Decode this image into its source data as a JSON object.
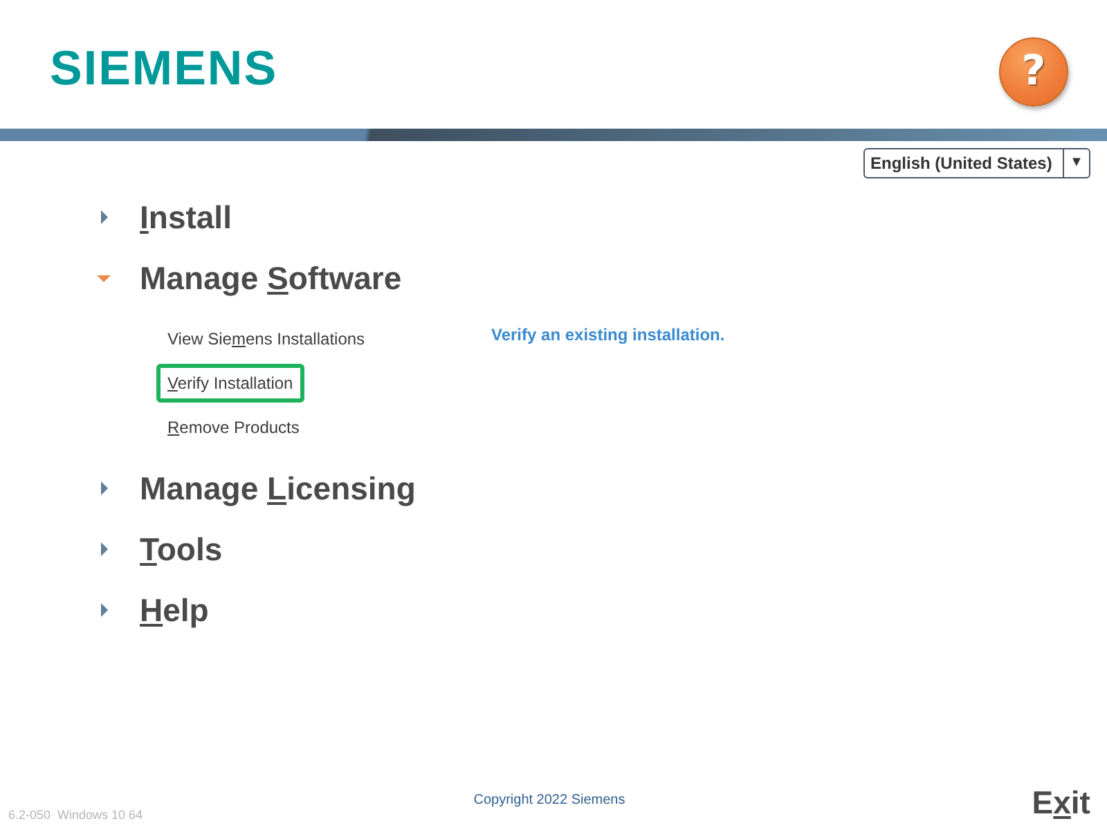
{
  "header": {
    "logo": "SIEMENS",
    "help_button": "?"
  },
  "language_select": {
    "value": "English (United States)",
    "arrow": "▼"
  },
  "menu": [
    {
      "label": {
        "access_key": "I",
        "after": "nstall"
      },
      "expanded": false
    },
    {
      "label": {
        "before": "Manage ",
        "access_key": "S",
        "after": "oftware"
      },
      "expanded": true,
      "children": [
        {
          "label": {
            "before": "View Sie",
            "access_key": "m",
            "after": "ens Installations"
          },
          "selected": false
        },
        {
          "label": {
            "access_key": "V",
            "after": "erify Installation"
          },
          "selected": true
        },
        {
          "label": {
            "access_key": "R",
            "after": "emove Products"
          },
          "selected": false
        }
      ]
    },
    {
      "label": {
        "before": "Manage ",
        "access_key": "L",
        "after": "icensing"
      },
      "expanded": false
    },
    {
      "label": {
        "access_key": "T",
        "after": "ools"
      },
      "expanded": false
    },
    {
      "label": {
        "access_key": "H",
        "after": "elp"
      },
      "expanded": false
    }
  ],
  "description": "Verify an existing installation.",
  "footer": {
    "version": "6.2-050  Windows 10 64",
    "copyright": "Copyright 2022 Siemens",
    "exit": {
      "before": "E",
      "access_key": "x",
      "after": "it"
    }
  }
}
